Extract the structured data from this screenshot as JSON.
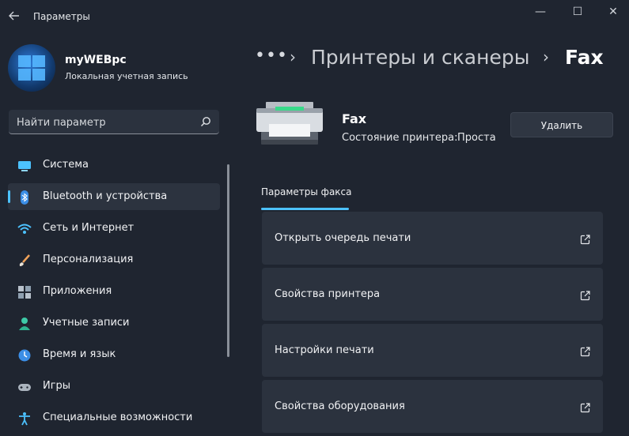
{
  "window": {
    "title": "Параметры",
    "back_icon": "back-arrow-icon",
    "minimize_label": "—",
    "maximize_label": "☐",
    "close_label": "✕"
  },
  "profile": {
    "name": "myWEBpc",
    "account_type": "Локальная учетная запись"
  },
  "search": {
    "placeholder": "Найти параметр"
  },
  "sidebar": {
    "items": [
      {
        "label": "Система",
        "icon": "system-icon",
        "active": false
      },
      {
        "label": "Bluetooth и устройства",
        "icon": "bluetooth-icon",
        "active": true
      },
      {
        "label": "Сеть и Интернет",
        "icon": "wifi-icon",
        "active": false
      },
      {
        "label": "Персонализация",
        "icon": "brush-icon",
        "active": false
      },
      {
        "label": "Приложения",
        "icon": "apps-icon",
        "active": false
      },
      {
        "label": "Учетные записи",
        "icon": "accounts-icon",
        "active": false
      },
      {
        "label": "Время и язык",
        "icon": "time-language-icon",
        "active": false
      },
      {
        "label": "Игры",
        "icon": "gamepad-icon",
        "active": false
      },
      {
        "label": "Специальные возможности",
        "icon": "accessibility-icon",
        "active": false
      }
    ]
  },
  "breadcrumb": {
    "more": "•••",
    "sep": "›",
    "parent": "Принтеры и сканеры",
    "current": "Fax"
  },
  "printer": {
    "name": "Fax",
    "status_label": "Состояние принтера:",
    "status_value": "Проста"
  },
  "actions": {
    "remove_label": "Удалить"
  },
  "tabs": [
    {
      "label": "Параметры факса",
      "active": true
    }
  ],
  "cards": [
    {
      "label": "Открыть очередь печати"
    },
    {
      "label": "Свойства принтера"
    },
    {
      "label": "Настройки печати"
    },
    {
      "label": "Свойства оборудования"
    }
  ],
  "colors": {
    "background": "#1f2530",
    "card": "#2b323e",
    "accent": "#4cc2ff"
  }
}
